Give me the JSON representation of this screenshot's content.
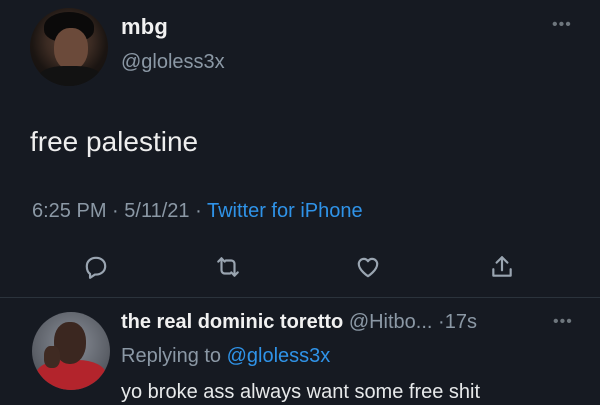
{
  "tweet": {
    "author_name": "mbg",
    "author_handle": "@gloless3x",
    "more_icon": "more-horizontal-icon",
    "text": "free palestine",
    "time": "6:25 PM",
    "date": "5/11/21",
    "separator": "·",
    "source": "Twitter for iPhone",
    "actions": [
      "reply-icon",
      "retweet-icon",
      "like-icon",
      "share-icon"
    ]
  },
  "reply": {
    "author_name": "the real dominic toretto",
    "author_handle": "@Hitbo...",
    "age": "17s",
    "separator": "·",
    "replying_prefix": "Replying to",
    "replying_to": "@gloless3x",
    "text": "yo broke ass always want some free shit",
    "more_icon": "more-horizontal-icon"
  },
  "colors": {
    "background": "#161a22",
    "text": "#e7e9ea",
    "secondary": "#8b98a5",
    "link": "#2f93e8"
  }
}
